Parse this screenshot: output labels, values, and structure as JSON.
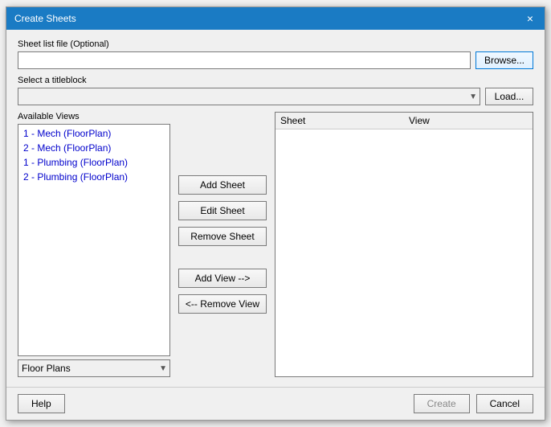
{
  "dialog": {
    "title": "Create Sheets",
    "close_label": "×"
  },
  "sheet_file": {
    "label": "Sheet list file (Optional)",
    "value": "",
    "placeholder": "",
    "browse_label": "Browse..."
  },
  "titleblock": {
    "label": "Select a titleblock",
    "options": [
      ""
    ],
    "load_label": "Load..."
  },
  "available_views": {
    "label": "Available Views",
    "items": [
      "1 - Mech (FloorPlan)",
      "2 - Mech (FloorPlan)",
      "1 - Plumbing (FloorPlan)",
      "2 - Plumbing (FloorPlan)"
    ]
  },
  "dropdown": {
    "options": [
      "Floor Plans"
    ],
    "selected": "Floor Plans"
  },
  "buttons": {
    "add_sheet": "Add Sheet",
    "edit_sheet": "Edit Sheet",
    "remove_sheet": "Remove Sheet",
    "add_view": "Add View -->",
    "remove_view": "<-- Remove View"
  },
  "table": {
    "col_sheet": "Sheet",
    "col_view": "View",
    "rows": []
  },
  "footer": {
    "help_label": "Help",
    "create_label": "Create",
    "cancel_label": "Cancel"
  }
}
